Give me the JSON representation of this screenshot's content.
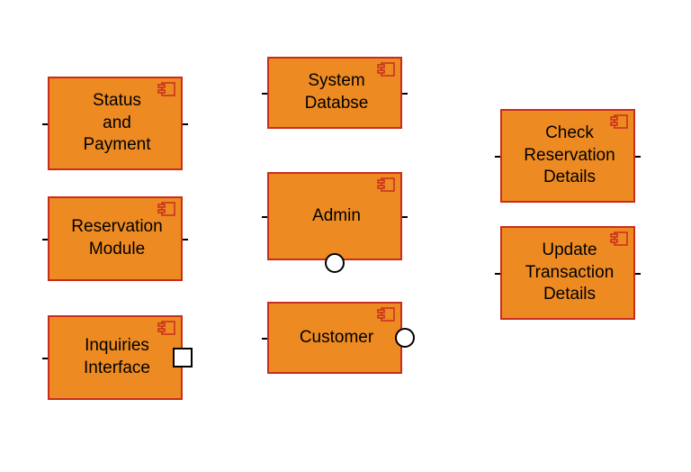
{
  "components": {
    "status_payment": "Status\nand\nPayment",
    "reservation_module": "Reservation\nModule",
    "inquiries_interface": "Inquiries\nInterface",
    "system_database": "System\nDatabse",
    "admin": "Admin",
    "customer": "Customer",
    "check_reservation": "Check\nReservation\nDetails",
    "update_transaction": "Update\nTransaction\nDetails"
  }
}
